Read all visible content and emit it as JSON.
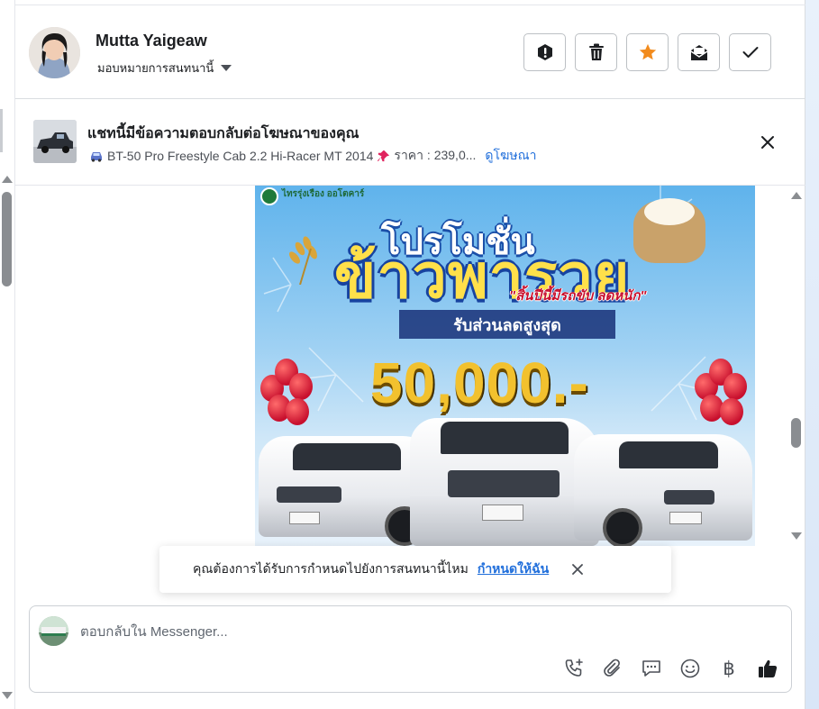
{
  "header": {
    "user_name": "Mutta Yaigeaw",
    "assign_label": "มอบหมายการสนทนานี้",
    "actions": [
      {
        "name": "report-button",
        "icon": "exclamation-icon"
      },
      {
        "name": "delete-button",
        "icon": "trash-icon"
      },
      {
        "name": "star-button",
        "icon": "star-icon"
      },
      {
        "name": "mark-unread-button",
        "icon": "envelope-icon"
      },
      {
        "name": "mark-done-button",
        "icon": "check-icon"
      }
    ]
  },
  "ad_context": {
    "title": "แชทนี้มีข้อความตอบกลับต่อโฆษณาของคุณ",
    "subtitle": "BT-50 Pro Freestyle Cab 2.2 Hi-Racer MT 2014",
    "price": "ราคา : 239,0...",
    "view_ad_link": "ดูโฆษณา"
  },
  "promo_image": {
    "brand_text": "ไทรรุ่งเรือง ออโตคาร์",
    "headline_top": "โปรโมชั่น",
    "headline_main": "ข้าวพารวย",
    "tagline": "\"สิ้นปีนี้มีรถขับ ลดหนัก\"",
    "discount_label": "รับส่วนลดสูงสุด",
    "discount_amount": "50,000.-"
  },
  "toast": {
    "message": "คุณต้องการได้รับการกำหนดไปยังการสนทนานี้ไหม",
    "action_link": "กำหนดให้ฉัน"
  },
  "composer": {
    "placeholder": "ตอบกลับใน Messenger...",
    "tools": [
      "phone-add-icon",
      "paperclip-icon",
      "saved-reply-icon",
      "emoji-icon",
      "baht-icon",
      "thumbs-up-icon"
    ],
    "baht_glyph": "฿"
  },
  "colors": {
    "accent_blue": "#216fdb",
    "star_orange": "#f28b1d",
    "border": "#bcc0c4"
  }
}
